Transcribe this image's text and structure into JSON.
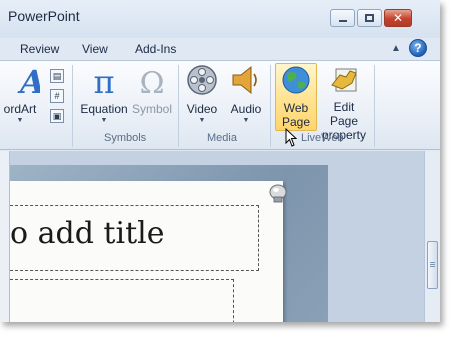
{
  "window": {
    "title": "PowerPoint"
  },
  "tabs": [
    "Review",
    "View",
    "Add-Ins"
  ],
  "help": {
    "label": "?"
  },
  "ribbon": {
    "wordart": {
      "label": "ordArt"
    },
    "symbols": {
      "group_label": "Symbols",
      "equation": {
        "label": "Equation"
      },
      "symbol": {
        "label": "Symbol"
      }
    },
    "media": {
      "group_label": "Media",
      "video": {
        "label": "Video"
      },
      "audio": {
        "label": "Audio"
      }
    },
    "liveweb": {
      "group_label": "LiveWeb",
      "web_page": {
        "line1": "Web",
        "line2": "Page"
      },
      "edit_page": {
        "line1": "Edit Page",
        "line2": "property"
      }
    }
  },
  "slide": {
    "title_placeholder": "o add title"
  },
  "colors": {
    "active_button": "#ffe69a",
    "accent": "#1f5fb8"
  }
}
